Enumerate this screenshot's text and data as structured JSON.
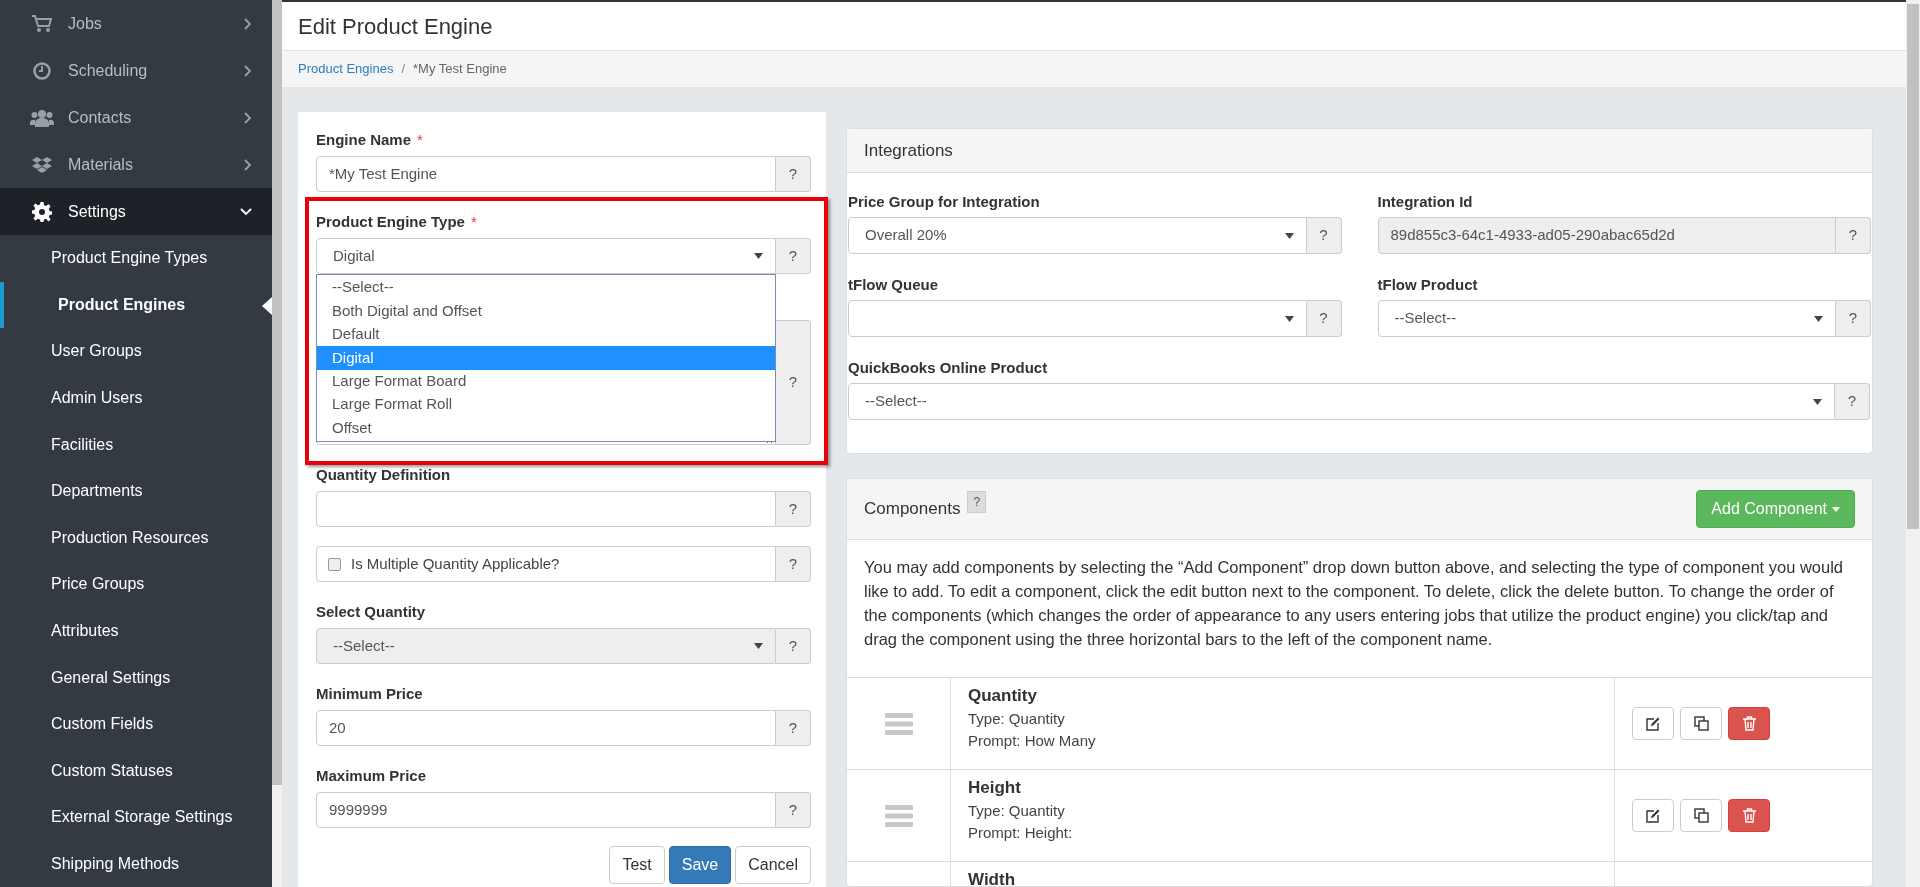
{
  "sidebar": {
    "items": [
      {
        "label": "Jobs",
        "expanded": false
      },
      {
        "label": "Scheduling",
        "expanded": false
      },
      {
        "label": "Contacts",
        "expanded": false
      },
      {
        "label": "Materials",
        "expanded": false
      },
      {
        "label": "Settings",
        "expanded": true,
        "children": [
          {
            "label": "Product Engine Types",
            "selected": false
          },
          {
            "label": "Product Engines",
            "selected": true
          },
          {
            "label": "User Groups",
            "selected": false
          },
          {
            "label": "Admin Users",
            "selected": false
          },
          {
            "label": "Facilities",
            "selected": false
          },
          {
            "label": "Departments",
            "selected": false
          },
          {
            "label": "Production Resources",
            "selected": false
          },
          {
            "label": "Price Groups",
            "selected": false
          },
          {
            "label": "Attributes",
            "selected": false
          },
          {
            "label": "General Settings",
            "selected": false
          },
          {
            "label": "Custom Fields",
            "selected": false
          },
          {
            "label": "Custom Statuses",
            "selected": false
          },
          {
            "label": "External Storage Settings",
            "selected": false
          },
          {
            "label": "Shipping Methods",
            "selected": false
          }
        ]
      }
    ]
  },
  "header": {
    "title": "Edit Product Engine"
  },
  "breadcrumb": {
    "separator": "/",
    "items": [
      {
        "label": "Product Engines",
        "link": true
      },
      {
        "label": "*My Test Engine",
        "link": false
      }
    ]
  },
  "form": {
    "fields": [
      {
        "kind": "text",
        "label": "Engine Name",
        "required_mark": "*",
        "value": "*My Test Engine",
        "help": "?"
      },
      {
        "kind": "select",
        "label": "Product Engine Type",
        "required_mark": "*",
        "value": "Digital",
        "help": "?",
        "highlighted": true,
        "open": true,
        "options": [
          {
            "label": "--Select--",
            "selected": false
          },
          {
            "label": "Both Digital and Offset",
            "selected": false
          },
          {
            "label": "Default",
            "selected": false
          },
          {
            "label": "Digital",
            "selected": true
          },
          {
            "label": "Large Format Board",
            "selected": false
          },
          {
            "label": "Large Format Roll",
            "selected": false
          },
          {
            "label": "Offset",
            "selected": false
          }
        ]
      },
      {
        "kind": "textarea",
        "help": "?"
      },
      {
        "kind": "text",
        "label": "Quantity Definition",
        "help": "?"
      },
      {
        "kind": "checkbox",
        "label": "Is Multiple Quantity Applicable?",
        "checked": false,
        "help": "?"
      },
      {
        "kind": "select",
        "label": "Select Quantity",
        "value": "--Select--",
        "disabled": true,
        "help": "?"
      },
      {
        "kind": "text",
        "label": "Minimum Price",
        "value": "20",
        "help": "?"
      },
      {
        "kind": "text",
        "label": "Maximum Price",
        "value": "9999999",
        "help": "?"
      }
    ],
    "buttons": [
      {
        "label": "Test",
        "kind": "default"
      },
      {
        "label": "Save",
        "kind": "primary"
      },
      {
        "label": "Cancel",
        "kind": "default"
      }
    ]
  },
  "integrations": {
    "title": "Integrations",
    "fields": [
      {
        "kind": "select",
        "label": "Price Group for Integration",
        "value": "Overall 20%",
        "help": "?",
        "wide": false
      },
      {
        "kind": "text",
        "label": "Integration Id",
        "value": "89d855c3-64c1-4933-ad05-290abac65d2d",
        "disabled": true,
        "help": "?",
        "wide": false
      },
      {
        "kind": "select",
        "label": "tFlow Queue",
        "help": "?",
        "wide": false
      },
      {
        "kind": "select",
        "label": "tFlow Product",
        "value": "--Select--",
        "help": "?",
        "wide": false
      },
      {
        "kind": "select",
        "label": "QuickBooks Online Product",
        "value": "--Select--",
        "help": "?",
        "wide": true
      }
    ]
  },
  "components": {
    "title": "Components",
    "help": "?",
    "add_button": "Add Component",
    "description": "You may add components by selecting the “Add Component” drop down button above, and selecting the type of component you would like to add. To edit a component, click the edit button next to the component. To delete, click the delete button. To change the order of the components (which changes the order of appearance to any users entering jobs that utilize the product engine) you click/tap and drag the component using the three horizontal bars to the left of the component name.",
    "rows": [
      {
        "name": "Quantity",
        "type": "Type: Quantity",
        "prompt": "Prompt: How Many"
      },
      {
        "name": "Height",
        "type": "Type: Quantity",
        "prompt": "Prompt: Height:"
      },
      {
        "name": "Width"
      }
    ]
  }
}
